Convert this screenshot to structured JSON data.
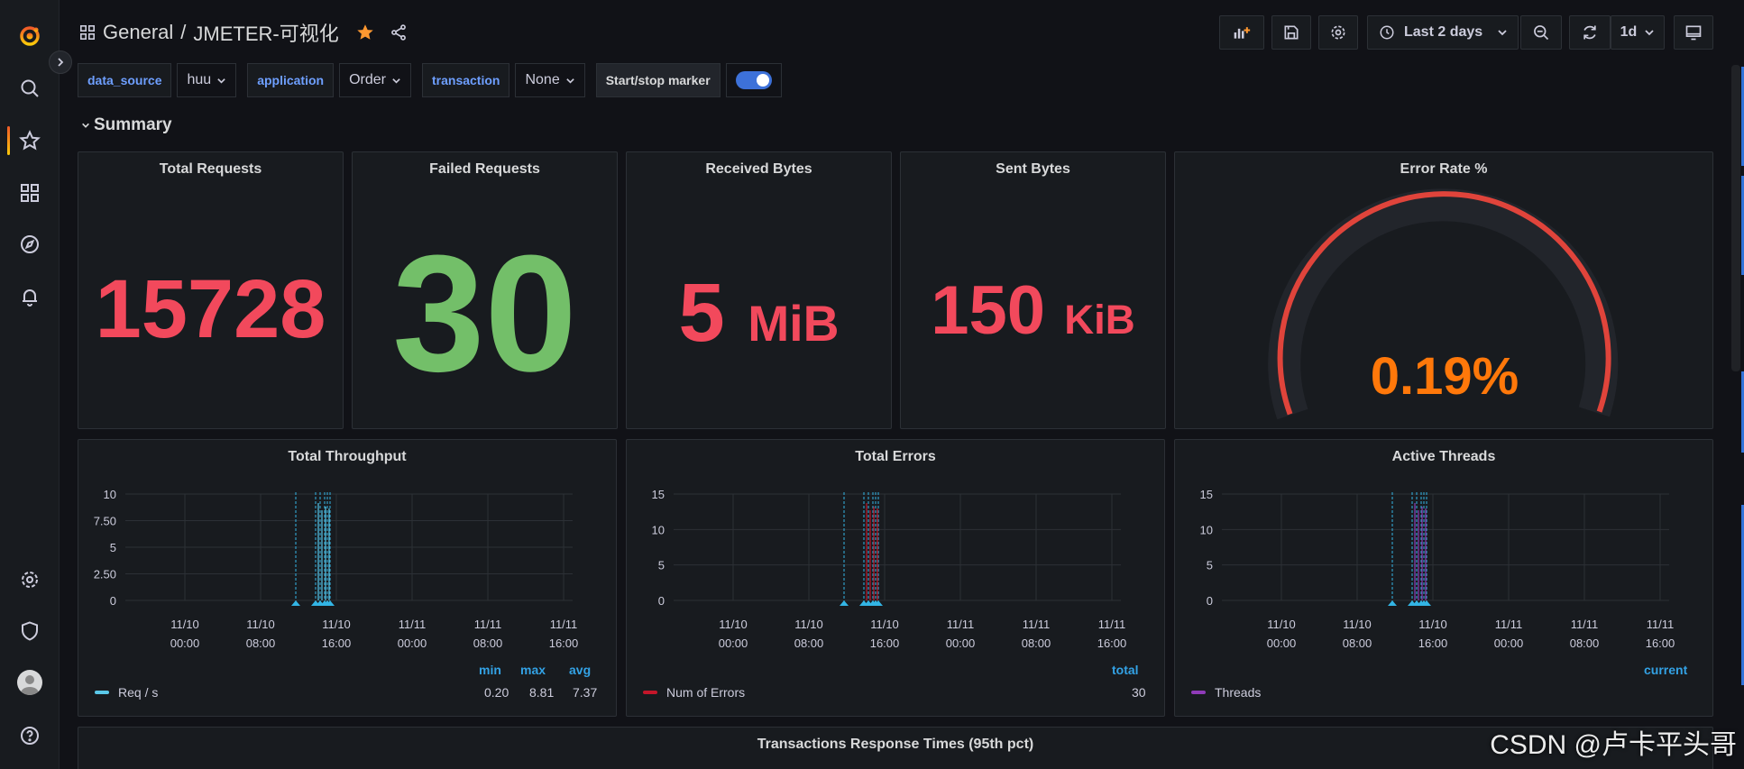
{
  "breadcrumb": {
    "folder": "General",
    "separator": "/",
    "dashboard": "JMETER-可视化"
  },
  "toolbar": {
    "time_range": "Last 2 days",
    "refresh_interval": "1d"
  },
  "variables": [
    {
      "label": "data_source",
      "value": "huu"
    },
    {
      "label": "application",
      "value": "Order"
    },
    {
      "label": "transaction",
      "value": "None"
    }
  ],
  "marker": {
    "label": "Start/stop marker",
    "enabled": true
  },
  "row": {
    "title": "Summary"
  },
  "stats": {
    "total_requests": {
      "title": "Total Requests",
      "value": "15728",
      "color": "#f2495c"
    },
    "failed_requests": {
      "title": "Failed Requests",
      "value": "30",
      "color": "#73bf69"
    },
    "received_bytes": {
      "title": "Received Bytes",
      "value": "5",
      "unit": "MiB",
      "color": "#f2495c"
    },
    "sent_bytes": {
      "title": "Sent Bytes",
      "value": "150",
      "unit": "KiB",
      "color": "#f2495c"
    }
  },
  "gauge": {
    "title": "Error Rate %",
    "value_text": "0.19%",
    "value": 0.19,
    "color": "#ff780a",
    "arc_color": "#e0443b"
  },
  "graphs": {
    "throughput": {
      "title": "Total Throughput",
      "yticks": [
        "10",
        "7.50",
        "5",
        "2.50",
        "0"
      ],
      "xticks": [
        [
          "11/10",
          "00:00"
        ],
        [
          "11/10",
          "08:00"
        ],
        [
          "11/10",
          "16:00"
        ],
        [
          "11/11",
          "00:00"
        ],
        [
          "11/11",
          "08:00"
        ],
        [
          "11/11",
          "16:00"
        ]
      ],
      "legend_headers": [
        "min",
        "max",
        "avg"
      ],
      "series": {
        "name": "Req / s",
        "color": "#5ac8e8",
        "values": [
          "0.20",
          "8.81",
          "7.37"
        ]
      }
    },
    "errors": {
      "title": "Total Errors",
      "yticks": [
        "15",
        "10",
        "5",
        "0"
      ],
      "xticks": [
        [
          "11/10",
          "00:00"
        ],
        [
          "11/10",
          "08:00"
        ],
        [
          "11/10",
          "16:00"
        ],
        [
          "11/11",
          "00:00"
        ],
        [
          "11/11",
          "08:00"
        ],
        [
          "11/11",
          "16:00"
        ]
      ],
      "legend_headers": [
        "total"
      ],
      "series": {
        "name": "Num of Errors",
        "color": "#c4162a",
        "values": [
          "30"
        ]
      }
    },
    "threads": {
      "title": "Active Threads",
      "yticks": [
        "15",
        "10",
        "5",
        "0"
      ],
      "xticks": [
        [
          "11/10",
          "00:00"
        ],
        [
          "11/10",
          "08:00"
        ],
        [
          "11/10",
          "16:00"
        ],
        [
          "11/11",
          "00:00"
        ],
        [
          "11/11",
          "08:00"
        ],
        [
          "11/11",
          "16:00"
        ]
      ],
      "legend_headers": [
        "current"
      ],
      "series": {
        "name": "Threads",
        "color": "#8f3bb8",
        "values": [
          ""
        ]
      }
    }
  },
  "bottom_panel": {
    "title": "Transactions Response Times (95th pct)"
  },
  "watermark": "CSDN @卢卡平头哥"
}
